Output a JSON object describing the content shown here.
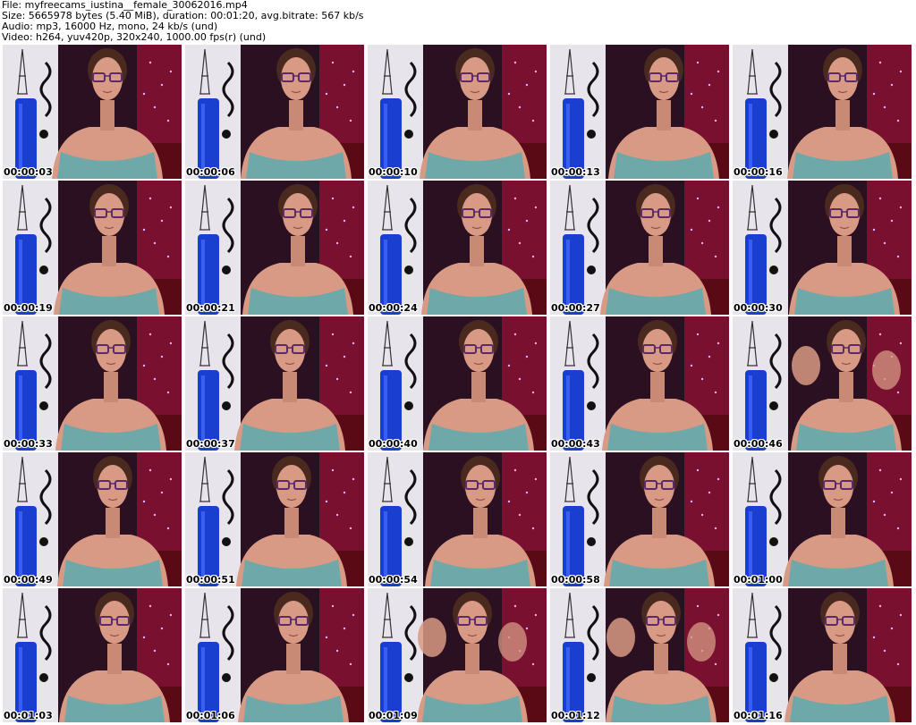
{
  "header": {
    "file_line": "File: myfreecams_iustina__female_30062016.mp4",
    "size_line": "Size: 5665978 bytes (5.40 MiB), duration: 00:01:20, avg.bitrate: 567 kb/s",
    "audio_line": "Audio: mp3, 16000 Hz, mono, 24 kb/s (und)",
    "video_line": "Video: h264, yuv420p, 320x240, 1000.00 fps(r) (und)"
  },
  "thumbnails": [
    {
      "timestamp": "00:00:03"
    },
    {
      "timestamp": "00:00:06"
    },
    {
      "timestamp": "00:00:10"
    },
    {
      "timestamp": "00:00:13"
    },
    {
      "timestamp": "00:00:16"
    },
    {
      "timestamp": "00:00:19"
    },
    {
      "timestamp": "00:00:21"
    },
    {
      "timestamp": "00:00:24"
    },
    {
      "timestamp": "00:00:27"
    },
    {
      "timestamp": "00:00:30"
    },
    {
      "timestamp": "00:00:33"
    },
    {
      "timestamp": "00:00:37"
    },
    {
      "timestamp": "00:00:40"
    },
    {
      "timestamp": "00:00:43"
    },
    {
      "timestamp": "00:00:46"
    },
    {
      "timestamp": "00:00:49"
    },
    {
      "timestamp": "00:00:51"
    },
    {
      "timestamp": "00:00:54"
    },
    {
      "timestamp": "00:00:58"
    },
    {
      "timestamp": "00:01:00"
    },
    {
      "timestamp": "00:01:03"
    },
    {
      "timestamp": "00:01:06"
    },
    {
      "timestamp": "00:01:09"
    },
    {
      "timestamp": "00:01:12"
    },
    {
      "timestamp": "00:01:16"
    }
  ],
  "colors": {
    "wall_white": "#e8e4ec",
    "curtain_red": "#8a1224",
    "dark_backdrop": "#2a1020",
    "blue_lamp": "#1a3fd0",
    "skin": "#d89a84",
    "top_teal": "#6fa8a8",
    "glasses": "#5a2a6a"
  }
}
